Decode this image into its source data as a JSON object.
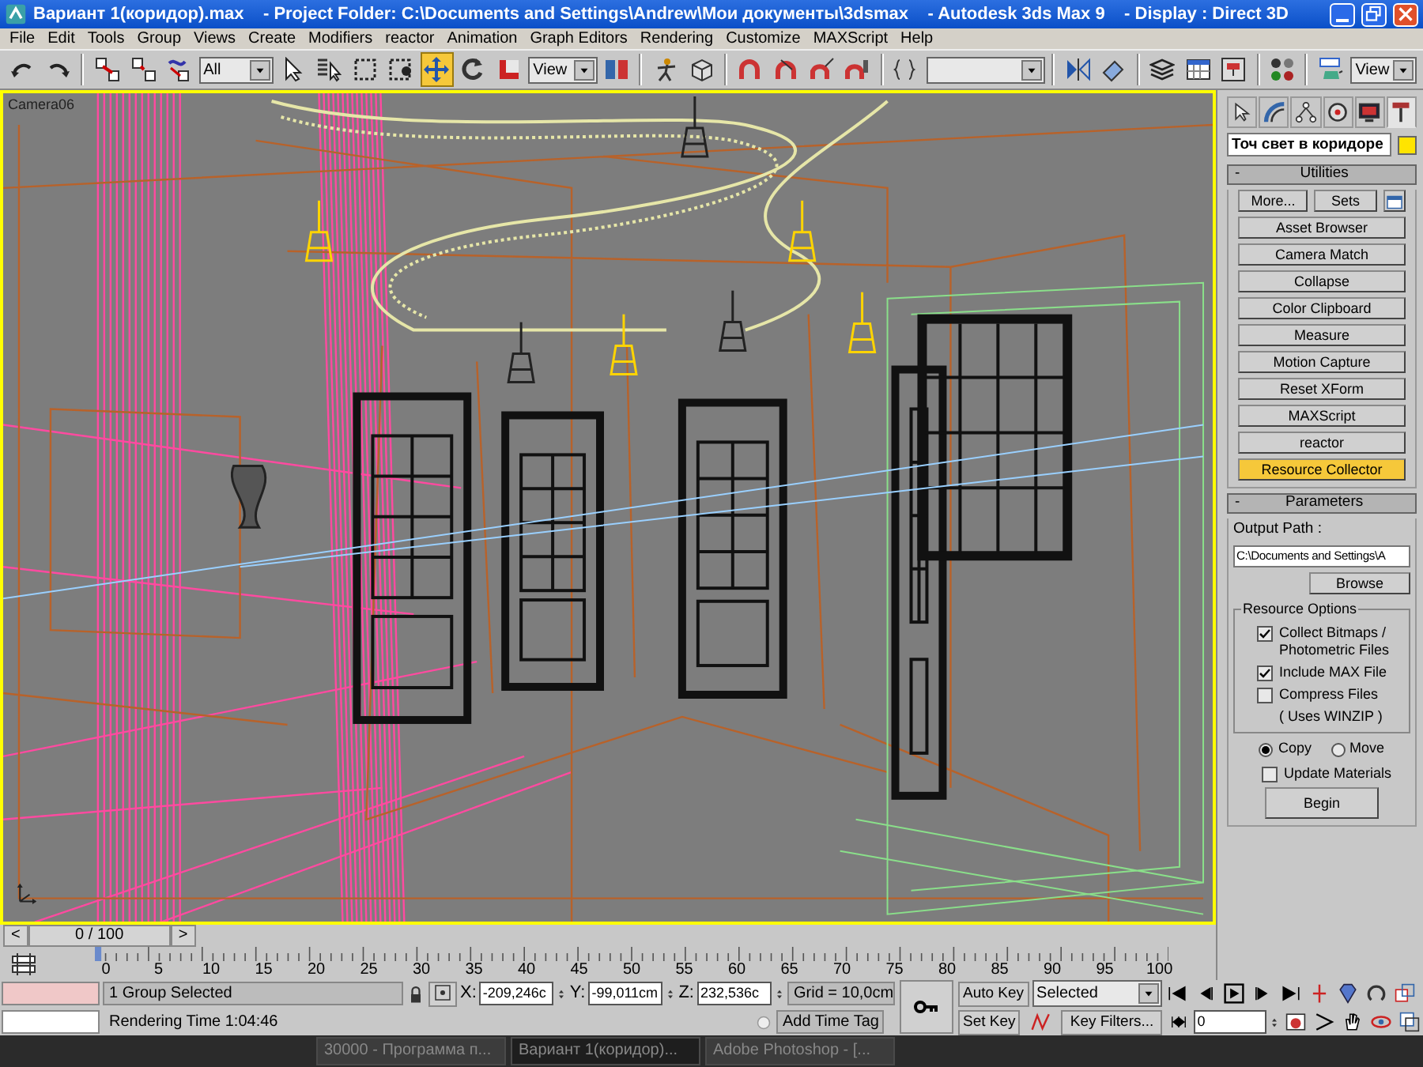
{
  "window": {
    "title": "Вариант 1(коридор).max    - Project Folder: C:\\Documents and Settings\\Andrew\\Мои документы\\3dsmax    - Autodesk 3ds Max 9    - Display : Direct 3D"
  },
  "menu": [
    "File",
    "Edit",
    "Tools",
    "Group",
    "Views",
    "Create",
    "Modifiers",
    "reactor",
    "Animation",
    "Graph Editors",
    "Rendering",
    "Customize",
    "MAXScript",
    "Help"
  ],
  "toolbar": [
    {
      "kind": "tool",
      "selected": false
    },
    {
      "kind": "tool",
      "selected": false
    },
    {
      "kind": "separator"
    },
    {
      "kind": "tool",
      "selected": false
    },
    {
      "kind": "tool",
      "selected": false
    },
    {
      "kind": "tool",
      "selected": false
    },
    {
      "kind": "dropdown",
      "value": "All"
    },
    {
      "kind": "tool",
      "selected": false
    },
    {
      "kind": "tool",
      "selected": false
    },
    {
      "kind": "tool",
      "selected": false
    },
    {
      "kind": "tool",
      "selected": false
    },
    {
      "kind": "tool",
      "selected": true
    },
    {
      "kind": "tool",
      "selected": false
    },
    {
      "kind": "tool",
      "selected": false
    },
    {
      "kind": "dropdown",
      "value": "View"
    },
    {
      "kind": "tool",
      "selected": false
    },
    {
      "kind": "separator"
    },
    {
      "kind": "tool",
      "selected": false
    },
    {
      "kind": "tool",
      "selected": false
    },
    {
      "kind": "separator"
    },
    {
      "kind": "tool",
      "selected": false
    },
    {
      "kind": "tool",
      "selected": false
    },
    {
      "kind": "tool",
      "selected": false
    },
    {
      "kind": "tool",
      "selected": false
    },
    {
      "kind": "separator"
    },
    {
      "kind": "tool",
      "selected": false
    },
    {
      "kind": "dropdown"
    },
    {
      "kind": "separator"
    },
    {
      "kind": "tool",
      "selected": false
    },
    {
      "kind": "tool",
      "selected": false
    },
    {
      "kind": "separator"
    },
    {
      "kind": "tool",
      "selected": false
    },
    {
      "kind": "tool",
      "selected": false
    },
    {
      "kind": "tool",
      "selected": false
    },
    {
      "kind": "separator"
    },
    {
      "kind": "tool",
      "selected": false
    },
    {
      "kind": "separator"
    },
    {
      "kind": "tool",
      "selected": false
    },
    {
      "kind": "dropdown",
      "value": "View"
    }
  ],
  "viewport": {
    "label": "Camera06",
    "active": true
  },
  "command_panel": {
    "tabs": [
      {
        "selected": false
      },
      {
        "selected": false
      },
      {
        "selected": false
      },
      {
        "selected": false
      },
      {
        "selected": false
      },
      {
        "selected": true
      }
    ],
    "object_name": "Точ свет в коридоре",
    "utilities": {
      "toggle": "-",
      "title": "Utilities",
      "more_button": "More...",
      "sets_button": "Sets",
      "buttons": [
        {
          "label": "Asset Browser",
          "selected": false
        },
        {
          "label": "Camera Match",
          "selected": false
        },
        {
          "label": "Collapse",
          "selected": false
        },
        {
          "label": "Color Clipboard",
          "selected": false
        },
        {
          "label": "Measure",
          "selected": false
        },
        {
          "label": "Motion Capture",
          "selected": false
        },
        {
          "label": "Reset XForm",
          "selected": false
        },
        {
          "label": "MAXScript",
          "selected": false
        },
        {
          "label": "reactor",
          "selected": false
        },
        {
          "label": "Resource Collector",
          "selected": true
        }
      ]
    },
    "parameters": {
      "toggle": "-",
      "title": "Parameters",
      "output_path_label": "Output Path :",
      "output_path": "C:\\Documents and Settings\\A",
      "browse_button": "Browse",
      "group_title": "Resource Options",
      "options": [
        {
          "kind": "checkbox",
          "label": "Collect Bitmaps / Photometric Files",
          "checked": true
        },
        {
          "kind": "checkbox",
          "label": "Include MAX File",
          "checked": true
        },
        {
          "kind": "checkbox",
          "label": "Compress Files",
          "checked": false
        },
        {
          "kind": "note",
          "label": "( Uses WINZIP )"
        }
      ],
      "copy_mode": [
        {
          "label": "Copy",
          "selected": true
        },
        {
          "label": "Move",
          "selected": false
        }
      ],
      "update_materials": {
        "label": "Update Materials",
        "checked": false
      },
      "begin_button": "Begin"
    }
  },
  "time_slider": {
    "prev": "<",
    "position": "0 / 100",
    "next": ">"
  },
  "track_bar": {
    "labels": [
      "0",
      "5",
      "10",
      "15",
      "20",
      "25",
      "30",
      "35",
      "40",
      "45",
      "50",
      "55",
      "60",
      "65",
      "70",
      "75",
      "80",
      "85",
      "90",
      "95",
      "100"
    ]
  },
  "status": {
    "selection": "1 Group Selected",
    "prompt": "Rendering Time  1:04:46",
    "x_label": "X:",
    "x": "-209,246c",
    "y_label": "Y:",
    "y": "-99,011cm",
    "z_label": "Z:",
    "z": "232,536c",
    "grid": "Grid = 10,0cm",
    "time_tag": "Add Time Tag"
  },
  "animation": {
    "auto_key": "Auto Key",
    "auto_key_on": false,
    "set_key": "Set Key",
    "key_set": "Selected",
    "key_filters": "Key Filters...",
    "frame": "0"
  },
  "taskbar": [
    {
      "label": "30000 - Программа п...",
      "active": false
    },
    {
      "label": "Вариант 1(коридор)...",
      "active": true
    },
    {
      "label": "Adobe Photoshop - [...",
      "active": false
    }
  ]
}
